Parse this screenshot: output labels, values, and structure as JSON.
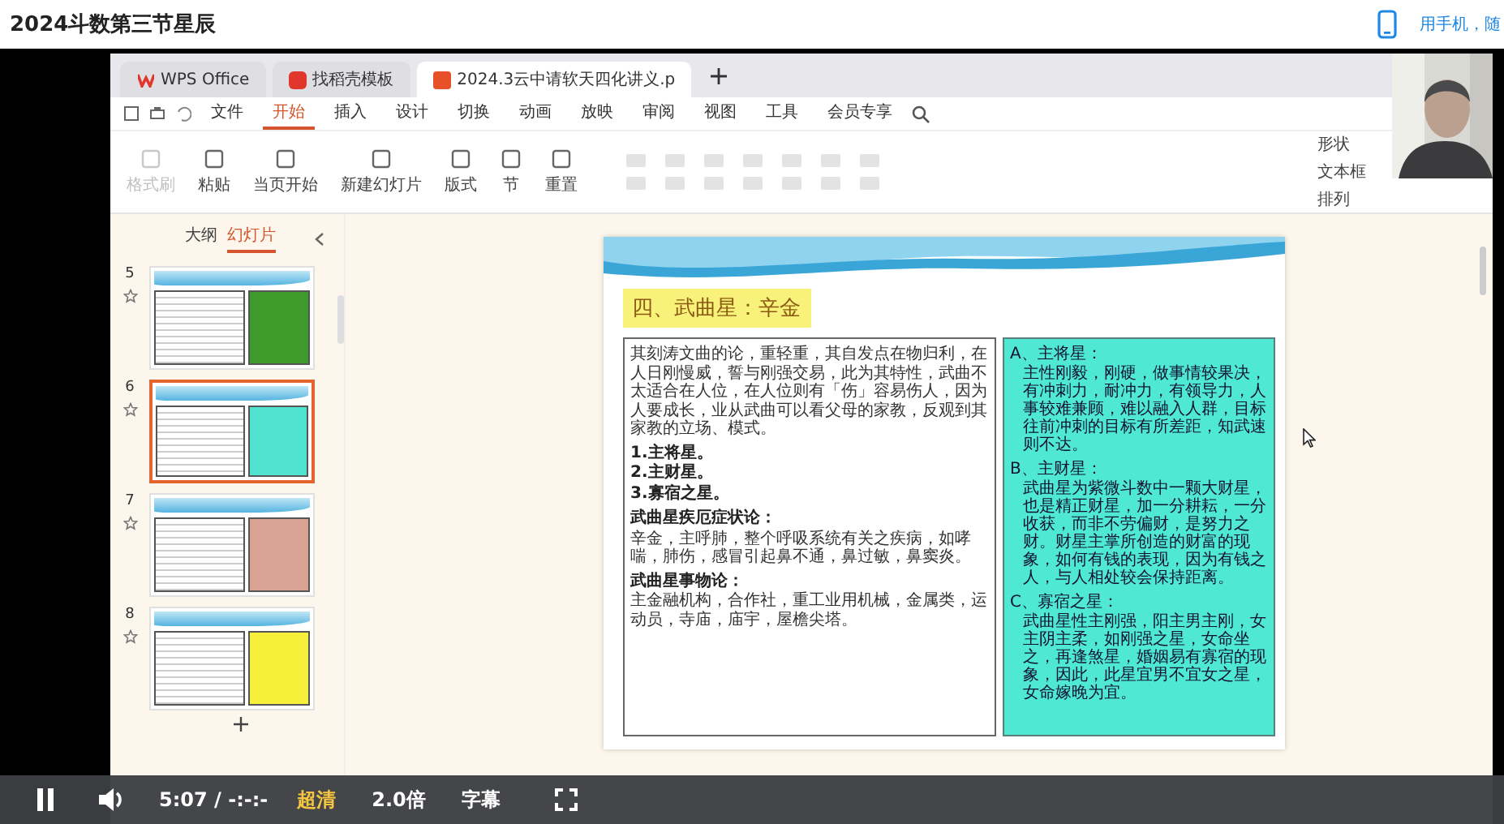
{
  "page": {
    "title": "2024斗数第三节星辰",
    "phone_link": "用手机，随"
  },
  "app": {
    "tabs": [
      {
        "label": "WPS Office",
        "selected": false,
        "kind": "home"
      },
      {
        "label": "找稻壳模板",
        "selected": false,
        "kind": "template"
      },
      {
        "label": "2024.3云中请软天四化讲义.p",
        "selected": true,
        "kind": "document"
      }
    ],
    "menu": [
      {
        "label": "文件",
        "selected": false
      },
      {
        "label": "开始",
        "selected": true
      },
      {
        "label": "插入",
        "selected": false
      },
      {
        "label": "设计",
        "selected": false
      },
      {
        "label": "切换",
        "selected": false
      },
      {
        "label": "动画",
        "selected": false
      },
      {
        "label": "放映",
        "selected": false
      },
      {
        "label": "审阅",
        "selected": false
      },
      {
        "label": "视图",
        "selected": false
      },
      {
        "label": "工具",
        "selected": false
      },
      {
        "label": "会员专享",
        "selected": false
      }
    ],
    "ribbon": [
      {
        "label": "格式刷",
        "disabled": true
      },
      {
        "label": "粘贴",
        "disabled": false
      },
      {
        "label": "当页开始",
        "disabled": false
      },
      {
        "label": "新建幻灯片",
        "disabled": false
      },
      {
        "label": "版式",
        "disabled": false
      },
      {
        "label": "节",
        "disabled": false
      },
      {
        "label": "重置",
        "disabled": false
      }
    ],
    "ribbon_right": [
      {
        "label": "形状",
        "disabled": false
      },
      {
        "label": "文本框",
        "disabled": false
      },
      {
        "label": "排列",
        "disabled": false
      }
    ]
  },
  "panel": {
    "tabs": [
      {
        "label": "大纲",
        "selected": false
      },
      {
        "label": "幻灯片",
        "selected": true
      }
    ],
    "thumbnails": [
      {
        "number": "5",
        "selected": false,
        "color": "#3f9a2c"
      },
      {
        "number": "6",
        "selected": true,
        "color": "#4fe3cf"
      },
      {
        "number": "7",
        "selected": false,
        "color": "#d9a394"
      },
      {
        "number": "8",
        "selected": false,
        "color": "#f6f03a"
      }
    ]
  },
  "slide": {
    "title": "四、武曲星：辛金",
    "intro": "其刻涛文曲的论，重轻重，其自发点在物归利，在人日刚慢威，誓与刚强交易，此为其特性，武曲不太适合在人位，在人位则有「伤」容易伤人，因为人要成长，业从武曲可以看父母的家教，反观到其家教的立场、模式。",
    "points": [
      "1.主将星。",
      "2.主财星。",
      "3.寡宿之星。"
    ],
    "sections": [
      {
        "heading": "武曲星疾厄症状论：",
        "text": "辛金，主呼肺，整个呼吸系统有关之疾病，如哮喘，肺伤，感冒引起鼻不通，鼻过敏，鼻窦炎。"
      },
      {
        "heading": "武曲星事物论：",
        "text": "主金融机构，合作社，重工业用机械，金属类，运动员，寺庙，庙宇，屋檐尖塔。"
      }
    ],
    "notes": [
      {
        "heading": "A、主将星：",
        "text": "主性刚毅，刚硬，做事情较果决，有冲刺力，耐冲力，有领导力，人事较难兼顾，难以融入人群，目标往前冲刺的目标有所差距，知武速则不达。"
      },
      {
        "heading": "B、主财星：",
        "text": "武曲星为紫微斗数中一颗大财星，也是精正财星，加一分耕耘，一分收获，而非不劳偏财，是努力之财。财星主掌所创造的财富的现象，如何有钱的表现，因为有钱之人，与人相处较会保持距离。"
      },
      {
        "heading": "C、寡宿之星：",
        "text": "武曲星性主刚强，阳主男主刚，女主阴主柔，如刚强之星，女命坐之，再逢煞星，婚姻易有寡宿的现象，因此，此星宜男不宜女之星，女命嫁晚为宜。"
      }
    ]
  },
  "player": {
    "playing": true,
    "time": "5:07 / -:-:-",
    "quality": "超清",
    "speed": "2.0倍",
    "subtitles": "字幕"
  }
}
